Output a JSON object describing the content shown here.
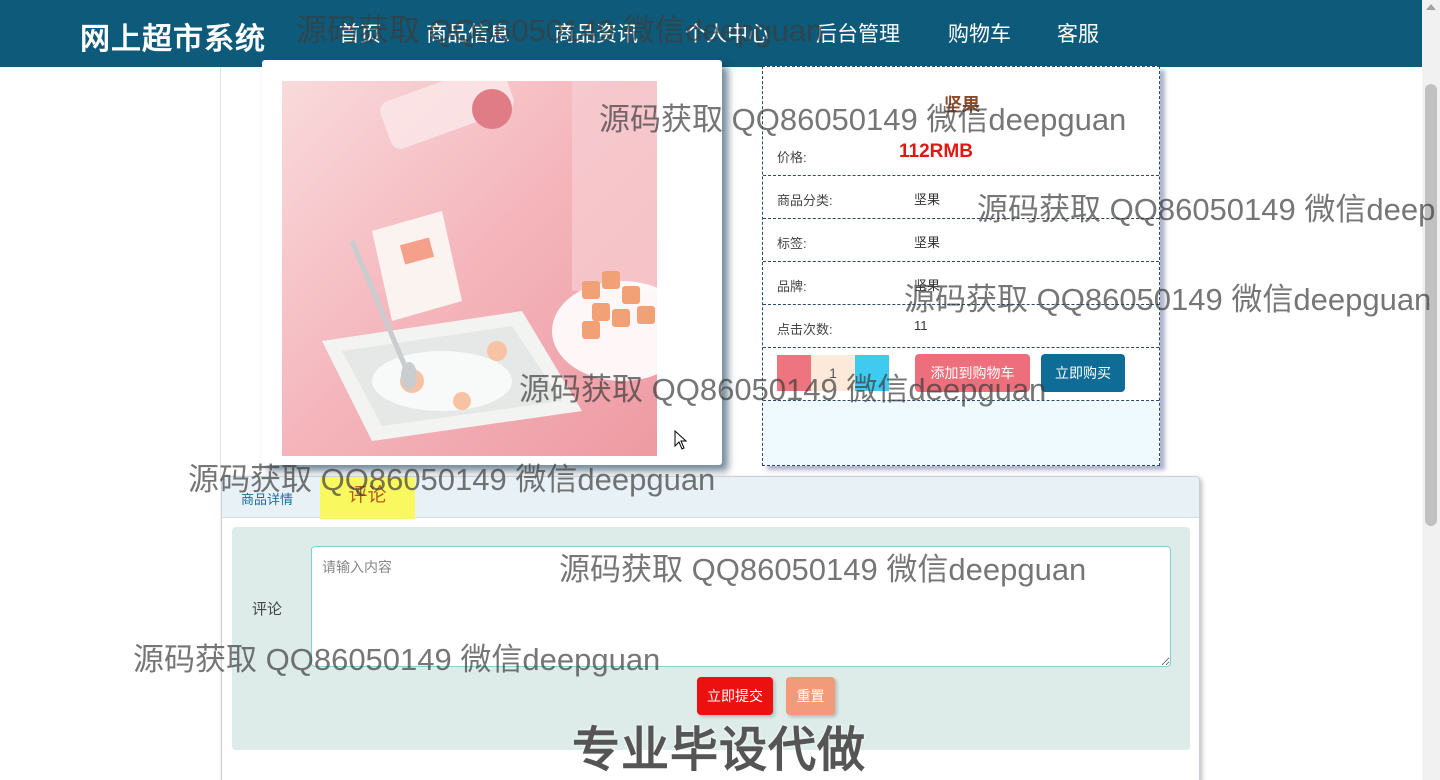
{
  "nav": {
    "brand": "网上超市系统",
    "items": [
      {
        "label": "首页",
        "active": false
      },
      {
        "label": "商品信息",
        "active": true
      },
      {
        "label": "商品资讯",
        "active": false
      },
      {
        "label": "个人中心",
        "active": false
      },
      {
        "label": "后台管理",
        "active": false
      },
      {
        "label": "购物车",
        "active": false
      },
      {
        "label": "客服",
        "active": false
      }
    ]
  },
  "product": {
    "name": "坚果",
    "price_label": "价格:",
    "price_value": "112RMB",
    "rows": [
      {
        "label": "商品分类:",
        "value": "坚果"
      },
      {
        "label": "标签:",
        "value": "坚果"
      },
      {
        "label": "品牌:",
        "value": "坚果"
      },
      {
        "label": "点击次数:",
        "value": "11"
      }
    ],
    "quantity": "1",
    "add_to_cart_label": "添加到购物车",
    "buy_now_label": "立即购买"
  },
  "tabs": {
    "detail_label": "商品详情",
    "comment_label": "评论"
  },
  "comment_form": {
    "label": "评论",
    "placeholder": "请输入内容",
    "submit_label": "立即提交",
    "reset_label": "重置"
  },
  "watermarks": {
    "line": "源码获取 QQ86050149 微信deepguan",
    "line_cut": "源码获取 QQ86050149 微信deep",
    "banner": "专业毕设代做"
  },
  "colors": {
    "nav_bg": "#0e5a7a",
    "price": "#e0180f",
    "cart_button": "#ed6f7c",
    "buy_button": "#0e6c96",
    "submit_button": "#ec1010",
    "reset_button": "#f29a7a",
    "comment_tab": "#faf85f"
  }
}
